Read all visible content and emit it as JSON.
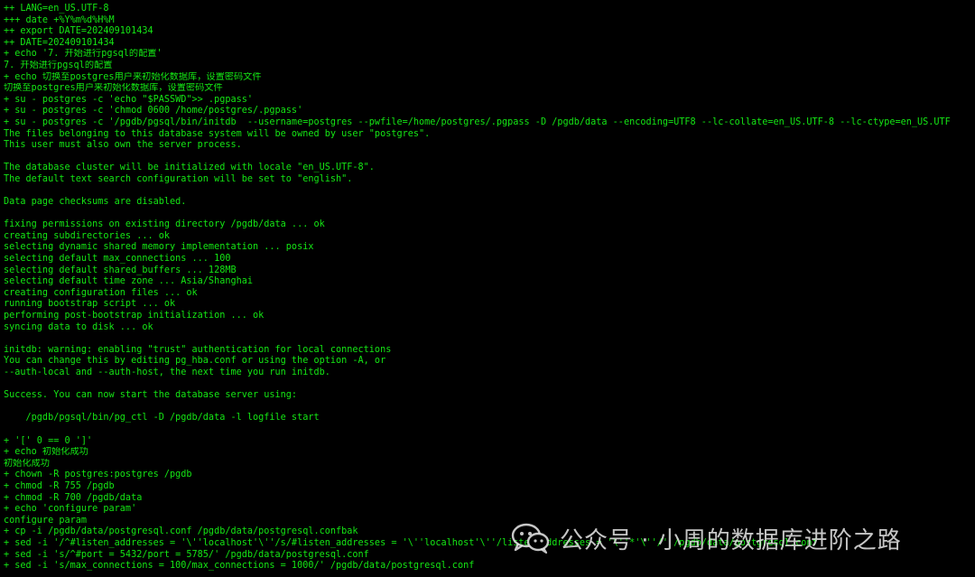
{
  "terminal": {
    "lines": [
      "++ LANG=en_US.UTF-8",
      "+++ date +%Y%m%d%H%M",
      "++ export DATE=202409101434",
      "++ DATE=202409101434",
      "+ echo '7. 开始进行pgsql的配置'",
      "7. 开始进行pgsql的配置",
      "+ echo 切换至postgres用户来初始化数据库，设置密码文件",
      "切换至postgres用户来初始化数据库，设置密码文件",
      "+ su - postgres -c 'echo \"$PASSWD\">> .pgpass'",
      "+ su - postgres -c 'chmod 0600 /home/postgres/.pgpass'",
      "+ su - postgres -c '/pgdb/pgsql/bin/initdb  --username=postgres --pwfile=/home/postgres/.pgpass -D /pgdb/data --encoding=UTF8 --lc-collate=en_US.UTF-8 --lc-ctype=en_US.UTF",
      "The files belonging to this database system will be owned by user \"postgres\".",
      "This user must also own the server process.",
      "",
      "The database cluster will be initialized with locale \"en_US.UTF-8\".",
      "The default text search configuration will be set to \"english\".",
      "",
      "Data page checksums are disabled.",
      "",
      "fixing permissions on existing directory /pgdb/data ... ok",
      "creating subdirectories ... ok",
      "selecting dynamic shared memory implementation ... posix",
      "selecting default max_connections ... 100",
      "selecting default shared_buffers ... 128MB",
      "selecting default time zone ... Asia/Shanghai",
      "creating configuration files ... ok",
      "running bootstrap script ... ok",
      "performing post-bootstrap initialization ... ok",
      "syncing data to disk ... ok",
      "",
      "initdb: warning: enabling \"trust\" authentication for local connections",
      "You can change this by editing pg_hba.conf or using the option -A, or",
      "--auth-local and --auth-host, the next time you run initdb.",
      "",
      "Success. You can now start the database server using:",
      "",
      "    /pgdb/pgsql/bin/pg_ctl -D /pgdb/data -l logfile start",
      "",
      "+ '[' 0 == 0 ']'",
      "+ echo 初始化成功",
      "初始化成功",
      "+ chown -R postgres:postgres /pgdb",
      "+ chmod -R 755 /pgdb",
      "+ chmod -R 700 /pgdb/data",
      "+ echo 'configure param'",
      "configure param",
      "+ cp -i /pgdb/data/postgresql.conf /pgdb/data/postgresql.confbak",
      "+ sed -i '/^#listen_addresses = '\\''localhost'\\''/s/#listen_addresses = '\\''localhost'\\''/listen_addresses = '\\''*'\\''/' /pgdb/data/postgresql.conf",
      "+ sed -i 's/^#port = 5432/port = 5785/' /pgdb/data/postgresql.conf",
      "+ sed -i 's/max_connections = 100/max_connections = 1000/' /pgdb/data/postgresql.conf"
    ],
    "text_color": "#14e614",
    "background_color": "#000000"
  },
  "watermark": {
    "icon": "wechat-icon",
    "text": "公众号 · 小周的数据库进阶之路"
  }
}
